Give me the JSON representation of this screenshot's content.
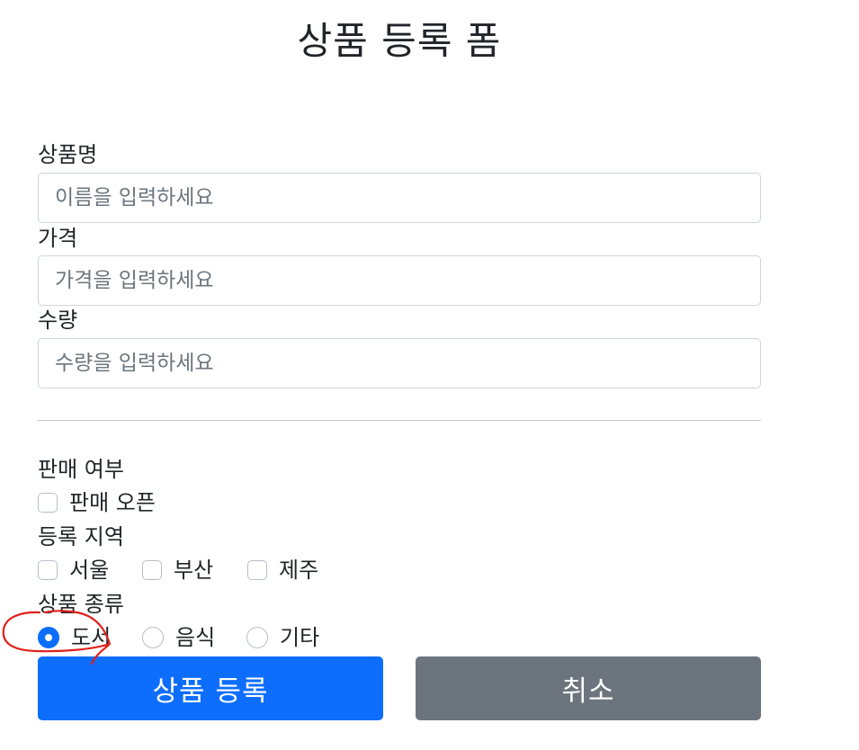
{
  "page": {
    "title": "상품 등록 폼"
  },
  "form": {
    "fields": [
      {
        "label": "상품명",
        "placeholder": "이름을 입력하세요"
      },
      {
        "label": "가격",
        "placeholder": "가격을 입력하세요"
      },
      {
        "label": "수량",
        "placeholder": "수량을 입력하세요"
      }
    ],
    "open": {
      "section_label": "판매 여부",
      "option": {
        "label": "판매 오픈",
        "checked": false
      }
    },
    "regions": {
      "section_label": "등록 지역",
      "options": [
        {
          "label": "서울",
          "checked": false
        },
        {
          "label": "부산",
          "checked": false
        },
        {
          "label": "제주",
          "checked": false
        }
      ]
    },
    "item_type": {
      "section_label": "상품 종류",
      "options": [
        {
          "label": "도서",
          "selected": true
        },
        {
          "label": "음식",
          "selected": false
        },
        {
          "label": "기타",
          "selected": false
        }
      ]
    },
    "buttons": {
      "submit_label": "상품 등록",
      "cancel_label": "취소"
    }
  },
  "colors": {
    "primary": "#0d6efd",
    "secondary": "#6c757d",
    "annotation": "#e0201c"
  }
}
